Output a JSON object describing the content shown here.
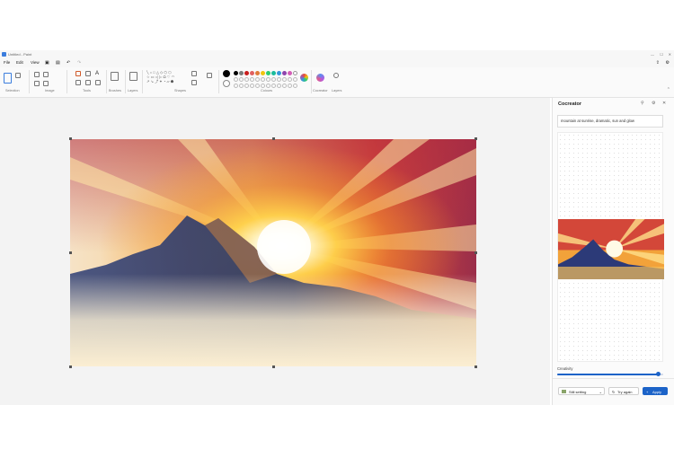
{
  "window": {
    "title": "Untitled - Paint"
  },
  "menu": {
    "items": [
      "File",
      "Edit",
      "View"
    ]
  },
  "ribbon": {
    "groups": [
      "Selection",
      "Image",
      "Tools",
      "Brushes",
      "Layers",
      "Shapes",
      "Colours",
      "Cocreator",
      "Layers"
    ]
  },
  "colors": {
    "palette": [
      "#000000",
      "#7a7a7a",
      "#c81e1e",
      "#e06060",
      "#e07b39",
      "#f1c40f",
      "#2ecc71",
      "#1abc9c",
      "#3498db",
      "#8e44ad",
      "#d35fb7",
      "#ffffff"
    ],
    "accent": "#1c63c8"
  },
  "cocreator": {
    "title": "Cocreator",
    "prompt": "mountain at sunrise, dramatic, sun and glow",
    "creativity_label": "Creativity",
    "creativity_level": 0.95,
    "style_label": "Still setting",
    "try_again_label": "Try again",
    "apply_label": "Apply"
  },
  "icons": {
    "pin": "pin-icon",
    "settings": "gear-icon",
    "close": "close-icon"
  }
}
